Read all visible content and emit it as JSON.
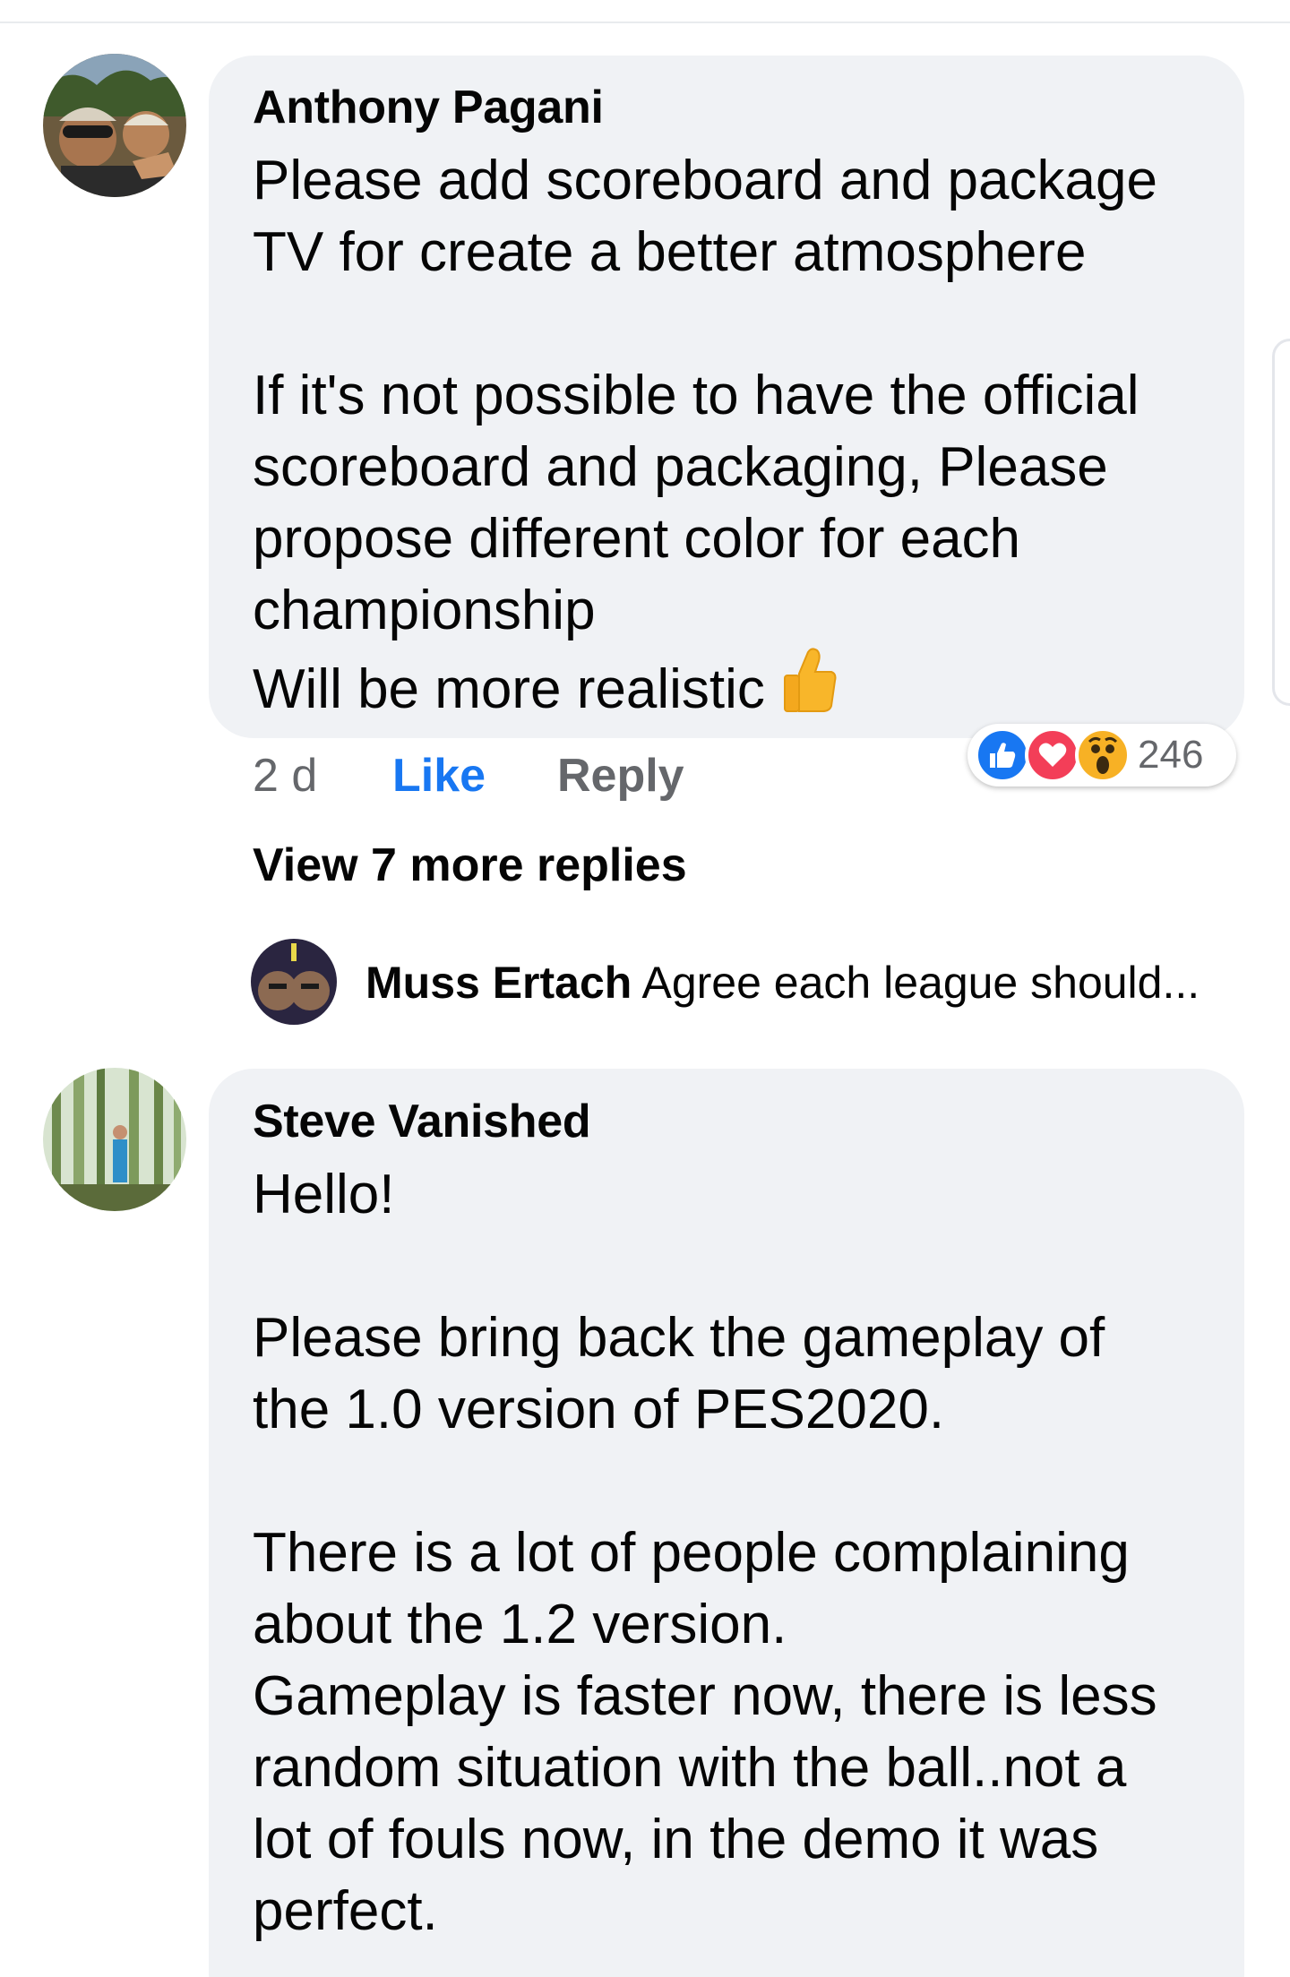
{
  "comments": [
    {
      "author": "Anthony Pagani",
      "body": "Please add scoreboard and package\nTV for create a better atmosphere\n\nIf it's not possible to have the official\nscoreboard and packaging, Please\npropose different color for each\nchampionship\nWill be more realistic",
      "emoji": "thumbs-up-icon",
      "time": "2 d",
      "like_label": "Like",
      "reply_label": "Reply",
      "reactions": [
        "like",
        "love",
        "wow"
      ],
      "reaction_count": "246",
      "view_more": "View 7 more replies",
      "reply_preview": {
        "author": "Muss Ertach",
        "text": "Agree each league should..."
      }
    },
    {
      "author": "Steve Vanished",
      "body": "Hello!\n\nPlease bring back the gameplay of\nthe 1.0 version of PES2020.\n\nThere is a lot of people complaining\nabout the 1.2 version.\nGameplay is faster now, there is less\nrandom situation with the ball..not a\nlot of fouls now, in the demo it was\nperfect."
    }
  ],
  "colors": {
    "bubble": "#f0f2f5",
    "like_blue": "#1877f2",
    "secondary_text": "#65676b",
    "love_red": "#f33e58",
    "wow_yellow": "#f7b125"
  }
}
